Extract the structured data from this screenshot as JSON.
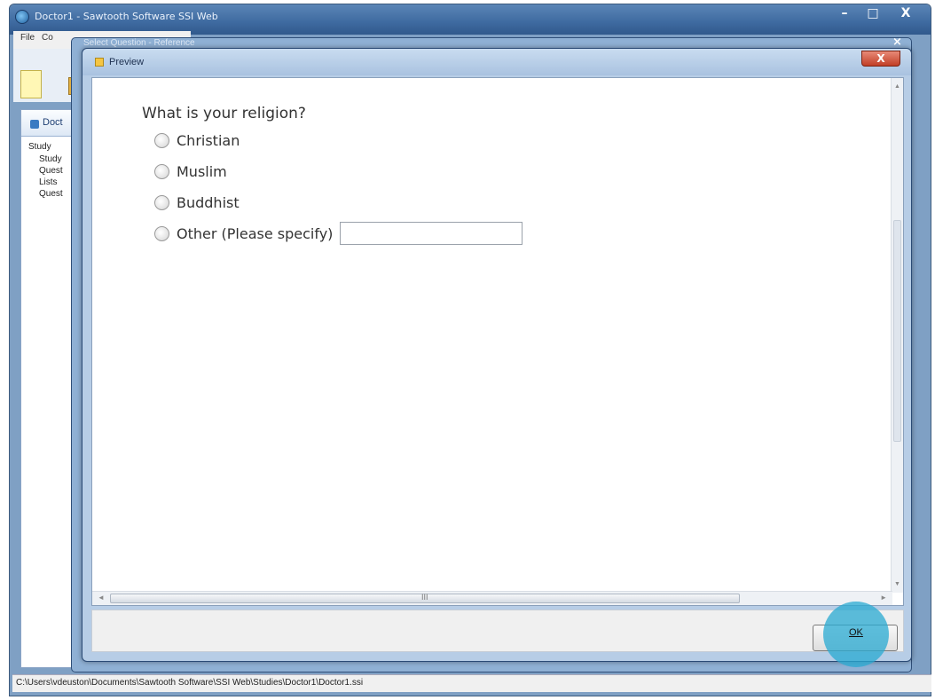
{
  "app": {
    "title": "Doctor1 - Sawtooth Software SSI Web",
    "minimize": "–",
    "maximize": "□",
    "close": "X"
  },
  "menubar": {
    "file": "File",
    "co": "Co"
  },
  "tree": {
    "header": "Doct",
    "root": "Study",
    "nodes": [
      "Study",
      "Quest",
      "Lists",
      "Quest"
    ]
  },
  "bg_dialog": {
    "title": "Select Question - Reference",
    "close": "×"
  },
  "preview": {
    "title": "Preview",
    "close": "X",
    "question": "What is your religion?",
    "options": [
      "Christian",
      "Muslim",
      "Buddhist",
      "Other (Please specify)"
    ],
    "ok_label": "OK",
    "hscroll_grip": "III"
  },
  "statusbar": {
    "path": "C:\\Users\\vdeuston\\Documents\\Sawtooth Software\\SSI Web\\Studies\\Doctor1\\Doctor1.ssi"
  }
}
